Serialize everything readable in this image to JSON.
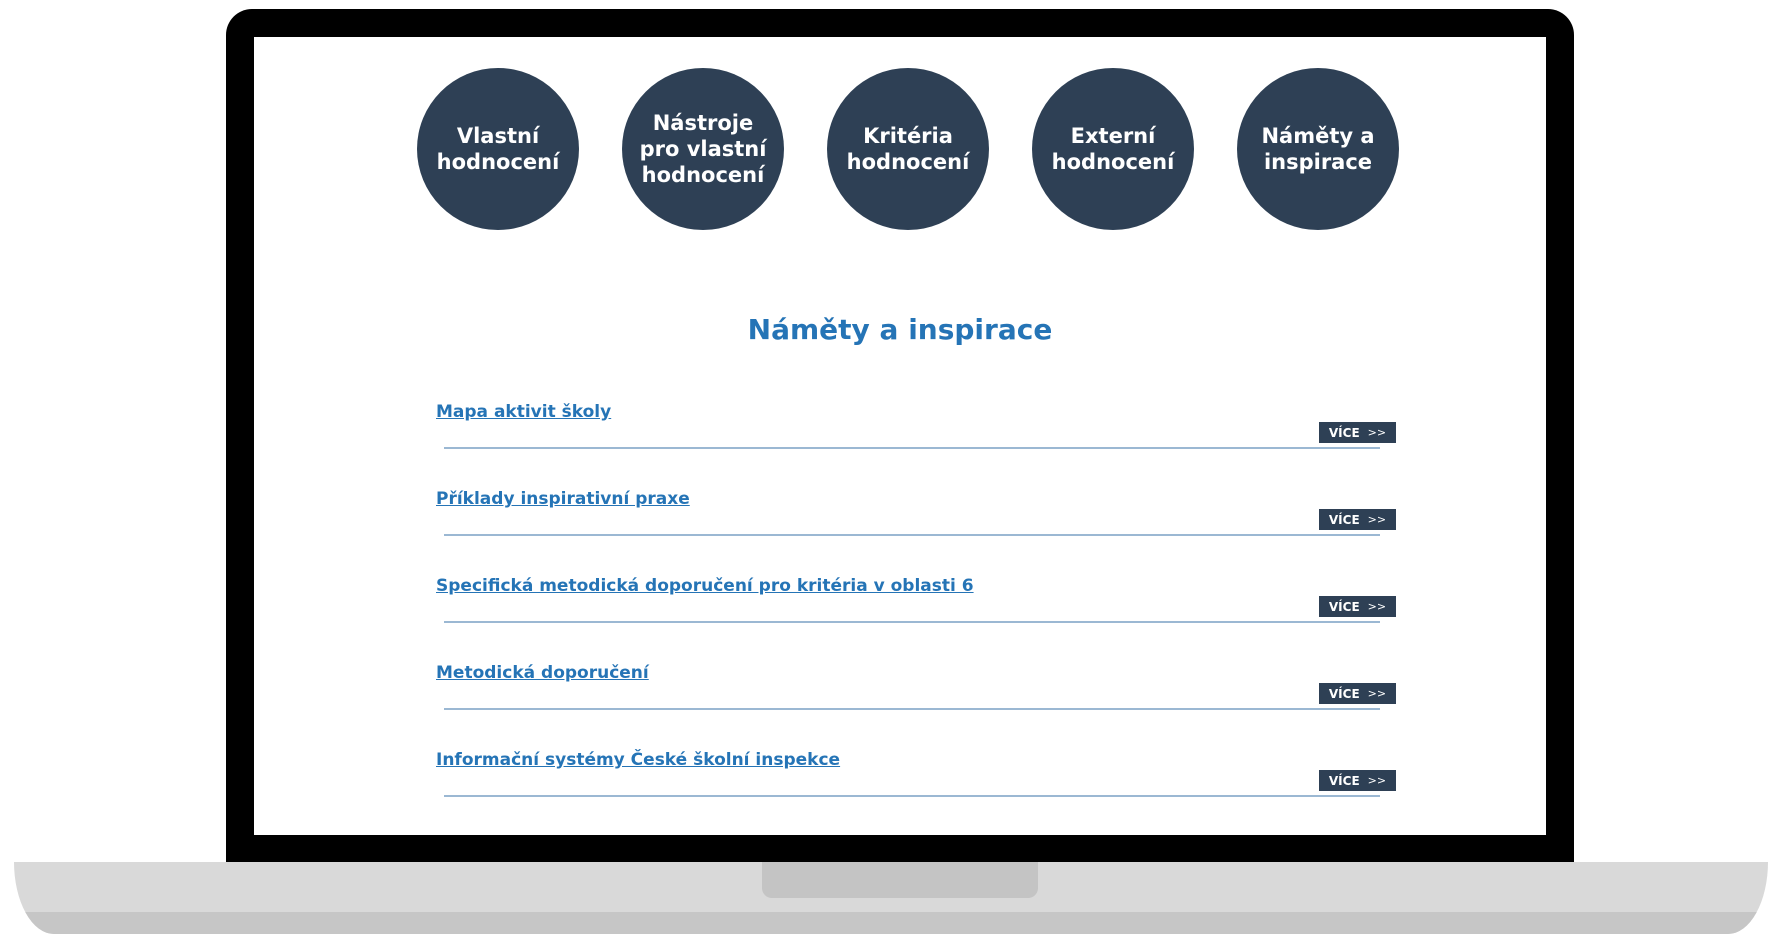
{
  "nav_circles": [
    {
      "label": "Vlastní\nhodnocení"
    },
    {
      "label": "Nástroje\npro vlastní\nhodnocení"
    },
    {
      "label": "Kritéria\nhodnocení"
    },
    {
      "label": "Externí\nhodnocení"
    },
    {
      "label": "Náměty a\ninspirace"
    }
  ],
  "section": {
    "title": "Náměty a inspirace"
  },
  "items": [
    {
      "title": "Mapa aktivit školy",
      "more_label": "VÍCE",
      "more_icon": ">>"
    },
    {
      "title": "Příklady inspirativní praxe",
      "more_label": "VÍCE",
      "more_icon": ">>"
    },
    {
      "title": "Specifická metodická doporučení pro kritéria v oblasti 6",
      "more_label": "VÍCE",
      "more_icon": ">>"
    },
    {
      "title": "Metodická doporučení",
      "more_label": "VÍCE",
      "more_icon": ">>"
    },
    {
      "title": "Informační systémy České školní inspekce",
      "more_label": "VÍCE",
      "more_icon": ">>"
    }
  ],
  "colors": {
    "accent": "#2574b6",
    "dark": "#2e4055",
    "divider": "#9bb8d3"
  }
}
